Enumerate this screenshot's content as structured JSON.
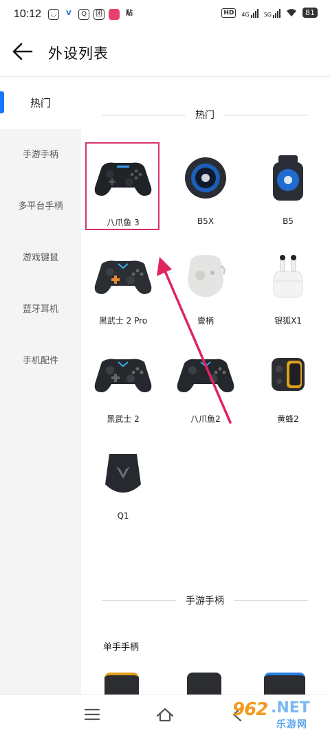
{
  "status_bar": {
    "time": "10:12",
    "app_icons": [
      "android-icon",
      "v-app-icon",
      "q-app-icon",
      "tuan-app-icon",
      "red-app-icon",
      "tie-app-icon"
    ],
    "network_hd": "HD",
    "signal_1": "4G",
    "signal_2": "5G",
    "battery": "81"
  },
  "header": {
    "title": "外设列表"
  },
  "sidebar": {
    "items": [
      {
        "label": "热门"
      },
      {
        "label": "手游手柄"
      },
      {
        "label": "多平台手柄"
      },
      {
        "label": "游戏键鼠"
      },
      {
        "label": "蓝牙耳机"
      },
      {
        "label": "手机配件"
      }
    ],
    "accent": "#1677ff"
  },
  "sections": {
    "hot": {
      "title": "热门",
      "devices": [
        {
          "name": "八爪鱼 3",
          "icon": "gamepad-icon"
        },
        {
          "name": "B5X",
          "icon": "cooler-fan-icon"
        },
        {
          "name": "B5",
          "icon": "cooler-clip-icon"
        },
        {
          "name": "黑武士 2 Pro",
          "icon": "gamepad-icon"
        },
        {
          "name": "壹柄",
          "icon": "mini-gamepad-icon"
        },
        {
          "name": "银狐X1",
          "icon": "earbuds-icon"
        },
        {
          "name": "黑武士 2",
          "icon": "gamepad-icon"
        },
        {
          "name": "八爪鱼2",
          "icon": "gamepad-icon"
        },
        {
          "name": "黄蜂2",
          "icon": "mobile-grip-icon"
        },
        {
          "name": "Q1",
          "icon": "dongle-icon"
        }
      ]
    },
    "mobile_gamepad": {
      "title": "手游手柄",
      "sub_title": "单手手柄"
    }
  },
  "watermark": {
    "num": "962",
    "suffix": ".NET",
    "cn": "乐游网"
  },
  "colors": {
    "highlight": "#d6336c",
    "arrow": "#e0245e"
  }
}
